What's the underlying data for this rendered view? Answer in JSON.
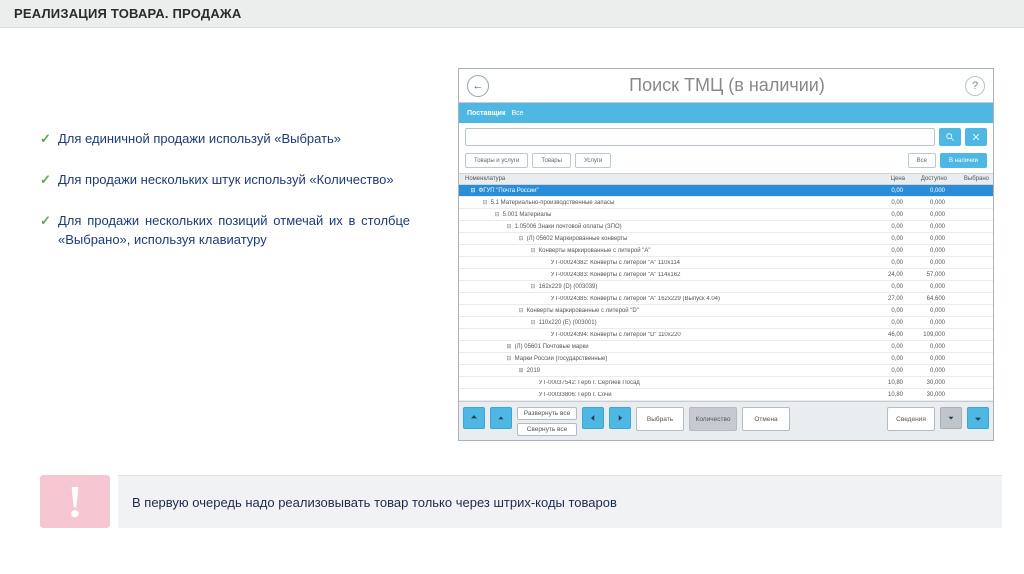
{
  "slide": {
    "title": "РЕАЛИЗАЦИЯ ТОВАРА. ПРОДАЖА",
    "bullets": [
      "Для единичной продажи используй «Выбрать»",
      "Для продажи нескольких штук используй «Количество»",
      "Для продажи нескольких позиций отмечай их в столбце «Выбрано», используя клавиатуру"
    ],
    "warning": "В первую очередь надо реализовывать товар только через штрих-коды товаров"
  },
  "app": {
    "window_title": "Поиск ТМЦ (в наличии)",
    "supplier_label": "Поставщик",
    "supplier_value": "Все",
    "tabs": {
      "goods_services": "Товары и услуги",
      "goods": "Товары",
      "services": "Услуги",
      "all": "Все",
      "in_stock": "В наличии"
    },
    "grid": {
      "cols": {
        "name": "Номенклатура",
        "price": "Цена",
        "available": "Доступно",
        "selected": "Выбрано"
      },
      "rows": [
        {
          "sel": true,
          "ind": 10,
          "exp": "⊟",
          "name": "ФГУП \"Почта России\"",
          "c1": "0,00",
          "c2": "0,000",
          "c3": ""
        },
        {
          "sel": false,
          "ind": 22,
          "exp": "⊟",
          "name": "5.1 Материально-производственные запасы",
          "c1": "0,00",
          "c2": "0,000",
          "c3": ""
        },
        {
          "sel": false,
          "ind": 34,
          "exp": "⊟",
          "name": "5.001 Материалы",
          "c1": "0,00",
          "c2": "0,000",
          "c3": ""
        },
        {
          "sel": false,
          "ind": 46,
          "exp": "⊟",
          "name": "1.05006 Знаки почтовой оплаты (ЗПО)",
          "c1": "0,00",
          "c2": "0,000",
          "c3": ""
        },
        {
          "sel": false,
          "ind": 58,
          "exp": "⊟",
          "name": "(Л) 05602 Маркированные конверты",
          "c1": "0,00",
          "c2": "0,000",
          "c3": ""
        },
        {
          "sel": false,
          "ind": 70,
          "exp": "⊟",
          "name": "Конверты маркированные с литерой \"А\"",
          "c1": "0,00",
          "c2": "0,000",
          "c3": ""
        },
        {
          "sel": false,
          "ind": 82,
          "exp": "",
          "name": "УТ-00024382: Конверты с литерой \"А\" 110х114",
          "c1": "0,00",
          "c2": "0,000",
          "c3": ""
        },
        {
          "sel": false,
          "ind": 82,
          "exp": "",
          "name": "УТ-00024383: Конверты с литерой \"А\" 114х162",
          "c1": "24,00",
          "c2": "57,000",
          "c3": ""
        },
        {
          "sel": false,
          "ind": 70,
          "exp": "⊟",
          "name": "162х229 (D) (003039)",
          "c1": "0,00",
          "c2": "0,000",
          "c3": ""
        },
        {
          "sel": false,
          "ind": 82,
          "exp": "",
          "name": "УТ-00024385: Конверты с литерой \"А\" 162х229 (Выпуск 4.04)",
          "c1": "27,00",
          "c2": "64,600",
          "c3": ""
        },
        {
          "sel": false,
          "ind": 58,
          "exp": "⊟",
          "name": "Конверты маркированные с литерой \"D\"",
          "c1": "0,00",
          "c2": "0,000",
          "c3": ""
        },
        {
          "sel": false,
          "ind": 70,
          "exp": "⊟",
          "name": "110х220 (Е) (003001)",
          "c1": "0,00",
          "c2": "0,000",
          "c3": ""
        },
        {
          "sel": false,
          "ind": 82,
          "exp": "",
          "name": "УТ-00024394: Конверты с литерой \"D\" 110х220",
          "c1": "46,00",
          "c2": "109,000",
          "c3": ""
        },
        {
          "sel": false,
          "ind": 46,
          "exp": "⊞",
          "name": "(Л) 05601 Почтовые марки",
          "c1": "0,00",
          "c2": "0,000",
          "c3": ""
        },
        {
          "sel": false,
          "ind": 46,
          "exp": "⊟",
          "name": "Марки России (государственные)",
          "c1": "0,00",
          "c2": "0,000",
          "c3": ""
        },
        {
          "sel": false,
          "ind": 58,
          "exp": "⊞",
          "name": "2019",
          "c1": "0,00",
          "c2": "0,000",
          "c3": ""
        },
        {
          "sel": false,
          "ind": 70,
          "exp": "",
          "name": "УТ-00037542: Герб г. Сергиев Посад",
          "c1": "10,80",
          "c2": "30,000",
          "c3": ""
        },
        {
          "sel": false,
          "ind": 70,
          "exp": "",
          "name": "УТ-00033806: Герб г. Сочи",
          "c1": "10,80",
          "c2": "30,000",
          "c3": ""
        }
      ]
    },
    "bottom": {
      "expand_all": "Развернуть все",
      "collapse_all": "Свернуть все",
      "select": "Выбрать",
      "quantity": "Количество",
      "cancel": "Отмена",
      "details": "Сведения"
    }
  }
}
